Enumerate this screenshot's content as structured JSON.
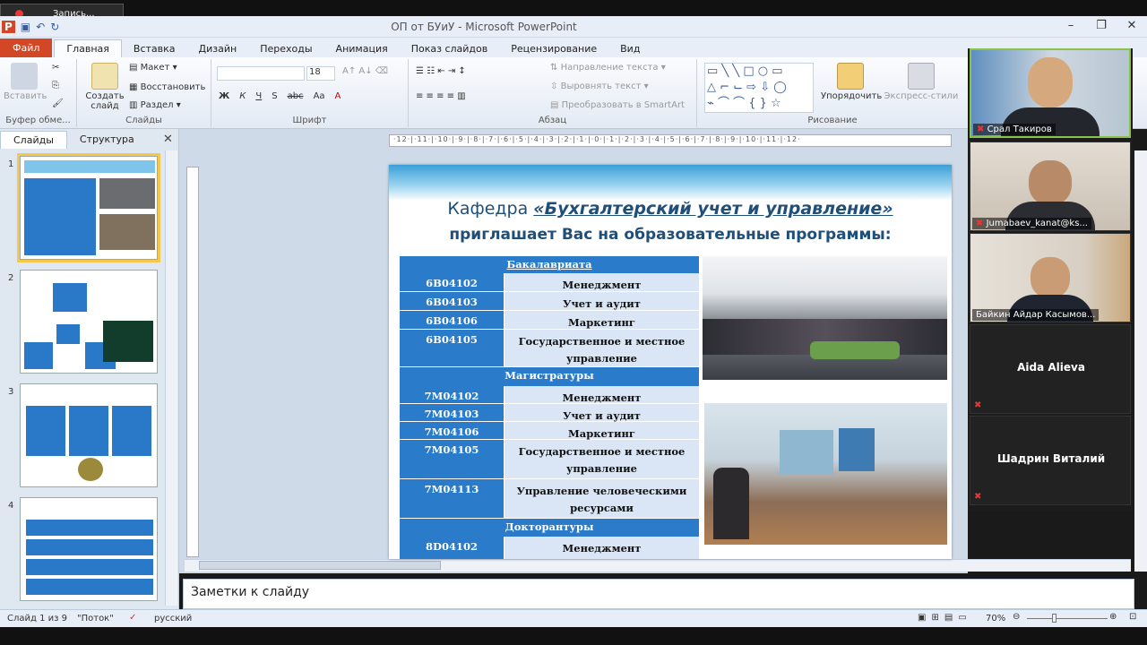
{
  "recording": {
    "label": "Запись..."
  },
  "window": {
    "title": "ОП  от БУиУ  -  Microsoft PowerPoint"
  },
  "ribbon_tabs": [
    "Файл",
    "Главная",
    "Вставка",
    "Дизайн",
    "Переходы",
    "Анимация",
    "Показ слайдов",
    "Рецензирование",
    "Вид"
  ],
  "ribbon": {
    "paste": "Вставить",
    "clipboard_group": "Буфер обме...",
    "new_slide": "Создать слайд",
    "layout": "Макет",
    "reset": "Восстановить",
    "section": "Раздел",
    "slides_group": "Слайды",
    "font_size": "18",
    "font_group": "Шрифт",
    "text_direction": "Направление текста",
    "align_text": "Выровнять текст",
    "smartart": "Преобразовать в SmartArt",
    "paragraph_group": "Абзац",
    "arrange": "Упорядочить",
    "quick_styles": "Экспресс-стили",
    "drawing_group": "Рисование",
    "font_buttons": [
      "Ж",
      "К",
      "Ч",
      "S",
      "abc",
      "Aa"
    ]
  },
  "left_pane": {
    "tab_slides": "Слайды",
    "tab_outline": "Структура",
    "slide_numbers": [
      "1",
      "2",
      "3",
      "4"
    ]
  },
  "ruler": {
    "marks": "·12·|·11·|·10·|·9·|·8·|·7·|·6·|·5·|·4·|·3·|·2·|·1·|·0·|·1·|·2·|·3·|·4·|·5·|·6·|·7·|·8·|·9·|·10·|·11·|·12·"
  },
  "slide": {
    "line1_prefix": "Кафедра ",
    "line1_name": "«Бухгалтерский учет и управление»",
    "line2": "приглашает Вас на образовательные программы:",
    "table": [
      {
        "header": "Бакалавриата"
      },
      {
        "code": "6В04102",
        "name": "Менеджмент"
      },
      {
        "code": "6В04103",
        "name": "Учет и аудит"
      },
      {
        "code": "6В04106",
        "name": "Маркетинг"
      },
      {
        "code": "6В04105",
        "name": "Государственное и местное управление"
      },
      {
        "header": "Магистратуры"
      },
      {
        "code": "7М04102",
        "name": "Менеджмент"
      },
      {
        "code": "7М04103",
        "name": "Учет и аудит"
      },
      {
        "code": "7М04106",
        "name": "Маркетинг"
      },
      {
        "code": "7М04105",
        "name": "Государственное и местное управление"
      },
      {
        "code": "7М04113",
        "name": "Управление человеческими ресурсами"
      },
      {
        "header": "Докторантуры"
      },
      {
        "code": "8D04102",
        "name": "Менеджмент"
      }
    ]
  },
  "notes": {
    "placeholder": "Заметки к слайду"
  },
  "status": {
    "slide": "Слайд 1 из 9",
    "theme": "\"Поток\"",
    "language": "русский",
    "zoom": "70%"
  },
  "participants": [
    {
      "name": "Срал Такиров",
      "video": true
    },
    {
      "name": "Jumabaev_kanat@ks...",
      "video": true
    },
    {
      "name": "Байкин Айдар Касымов...",
      "video": true
    },
    {
      "name": "Aida Alieva",
      "video": false
    },
    {
      "name": "Шадрин Виталий",
      "video": false
    }
  ],
  "colors": {
    "accent": "#2b7bcb",
    "file_tab": "#d24726",
    "title_text": "#1f4e79"
  }
}
